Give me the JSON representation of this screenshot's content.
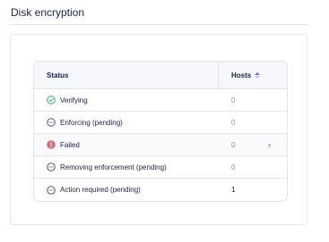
{
  "section": {
    "title": "Disk encryption"
  },
  "table": {
    "headers": {
      "status": "Status",
      "hosts": "Hosts"
    },
    "sort": {
      "column": "hosts",
      "direction": "ascending"
    },
    "rows": [
      {
        "icon": "check-circle-icon",
        "status": "Verifying",
        "hosts": "0"
      },
      {
        "icon": "pending-icon",
        "status": "Enforcing (pending)",
        "hosts": "0"
      },
      {
        "icon": "error-icon",
        "status": "Failed",
        "hosts": "0",
        "has_link": true
      },
      {
        "icon": "pending-icon",
        "status": "Removing enforcement (pending)",
        "hosts": "0"
      },
      {
        "icon": "pending-icon",
        "status": "Action required (pending)",
        "hosts": "1"
      }
    ]
  },
  "colors": {
    "success": "#3db67b",
    "error": "#d66c7b",
    "accent": "#6a67fe",
    "text": "#192147",
    "muted": "#8b8fa2"
  }
}
